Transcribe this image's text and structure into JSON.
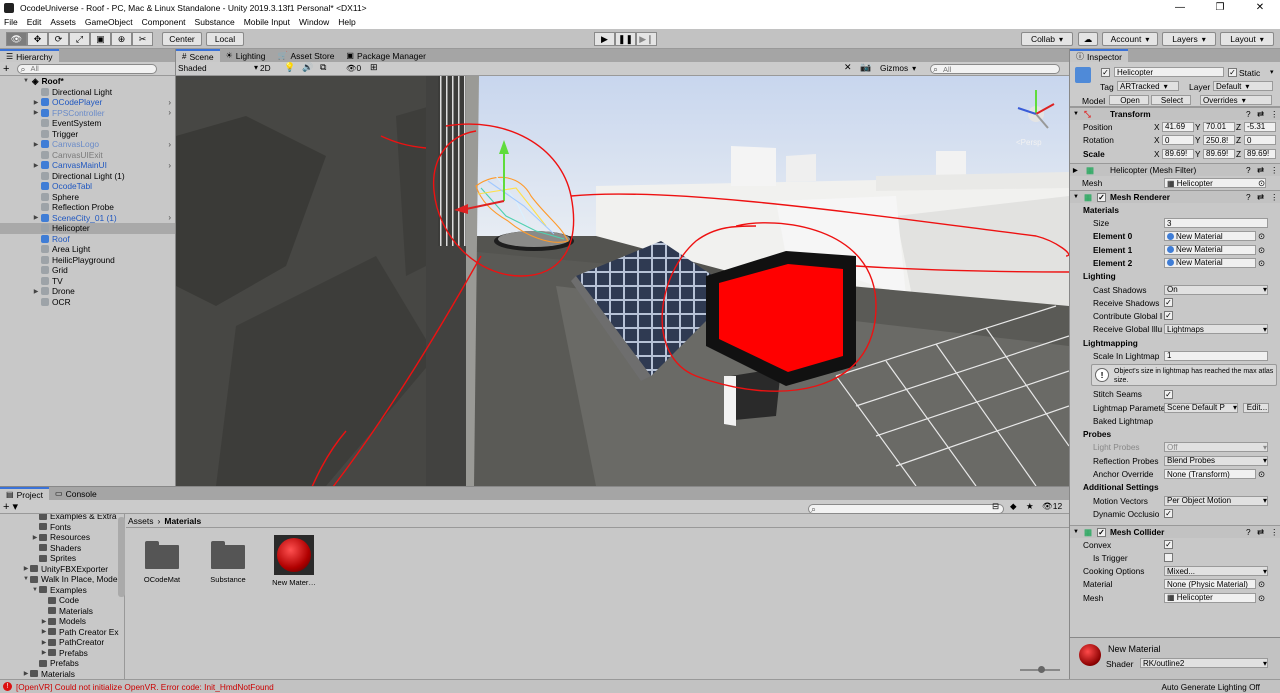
{
  "titlebar": {
    "title": "OcodeUniverse - Roof - PC, Mac & Linux Standalone - Unity 2019.3.13f1 Personal* <DX11>",
    "minimize": "—",
    "maximize": "❐",
    "close": "✕"
  },
  "menu": [
    "File",
    "Edit",
    "Assets",
    "GameObject",
    "Component",
    "Substance",
    "Mobile Input",
    "Window",
    "Help"
  ],
  "toolbar": {
    "center": "Center",
    "local": "Local",
    "collab": "Collab",
    "account": "Account",
    "layers": "Layers",
    "layout": "Layout"
  },
  "hierarchy": {
    "tab": "Hierarchy",
    "add": "+",
    "search_placeholder": "All",
    "root": "Roof*",
    "items": [
      {
        "label": "Directional Light",
        "style": "normal",
        "arrow": ""
      },
      {
        "label": "OCodePlayer",
        "style": "blue",
        "arrow": "▶"
      },
      {
        "label": "FPSController",
        "style": "bluegrey",
        "arrow": "▶"
      },
      {
        "label": "EventSystem",
        "style": "normal",
        "arrow": ""
      },
      {
        "label": "Trigger",
        "style": "normal",
        "arrow": ""
      },
      {
        "label": "CanvasLogo",
        "style": "bluegrey",
        "arrow": "▶"
      },
      {
        "label": "CanvasUIExit",
        "style": "grey",
        "arrow": ""
      },
      {
        "label": "CanvasMainUI",
        "style": "blue",
        "arrow": "▶"
      },
      {
        "label": "Directional Light (1)",
        "style": "normal",
        "arrow": ""
      },
      {
        "label": "OcodeTabl",
        "style": "blue",
        "arrow": ""
      },
      {
        "label": "Sphere",
        "style": "normal",
        "arrow": ""
      },
      {
        "label": "Reflection Probe",
        "style": "normal",
        "arrow": ""
      },
      {
        "label": "SceneCity_01 (1)",
        "style": "blue",
        "arrow": "▶"
      },
      {
        "label": "Helicopter",
        "style": "normal",
        "arrow": "",
        "selected": true
      },
      {
        "label": "Roof",
        "style": "blue",
        "arrow": ""
      },
      {
        "label": "Area Light",
        "style": "normal",
        "arrow": ""
      },
      {
        "label": "HeilicPlayground",
        "style": "normal",
        "arrow": ""
      },
      {
        "label": "Grid",
        "style": "normal",
        "arrow": ""
      },
      {
        "label": "TV",
        "style": "normal",
        "arrow": ""
      },
      {
        "label": "Drone",
        "style": "normal",
        "arrow": "▶"
      },
      {
        "label": "OCR",
        "style": "normal",
        "arrow": ""
      }
    ]
  },
  "scene": {
    "tabs": [
      "Scene",
      "Lighting",
      "Asset Store",
      "Package Manager"
    ],
    "shading": "Shaded",
    "mode2d": "2D",
    "layers_count": "0",
    "gizmos": "Gizmos",
    "search_placeholder": "All",
    "persp": "<Persp"
  },
  "project": {
    "tabs": [
      "Project",
      "Console"
    ],
    "breadcrumb": [
      "Assets",
      "Materials"
    ],
    "count": "12",
    "tree": [
      {
        "label": "Examples & Extra",
        "indent": 1,
        "arrow": ""
      },
      {
        "label": "Fonts",
        "indent": 1,
        "arrow": ""
      },
      {
        "label": "Resources",
        "indent": 1,
        "arrow": "▶"
      },
      {
        "label": "Shaders",
        "indent": 1,
        "arrow": ""
      },
      {
        "label": "Sprites",
        "indent": 1,
        "arrow": ""
      },
      {
        "label": "UnityFBXExporter",
        "indent": 0,
        "arrow": "▶"
      },
      {
        "label": "Walk In Place, Mode",
        "indent": 0,
        "arrow": "▼"
      },
      {
        "label": "Examples",
        "indent": 1,
        "arrow": "▼"
      },
      {
        "label": "Code",
        "indent": 2,
        "arrow": ""
      },
      {
        "label": "Materials",
        "indent": 2,
        "arrow": ""
      },
      {
        "label": "Models",
        "indent": 2,
        "arrow": "▶"
      },
      {
        "label": "Path Creator Ex",
        "indent": 2,
        "arrow": "▶"
      },
      {
        "label": "PathCreator",
        "indent": 2,
        "arrow": "▶"
      },
      {
        "label": "Prefabs",
        "indent": 2,
        "arrow": "▶"
      },
      {
        "label": "Prefabs",
        "indent": 1,
        "arrow": ""
      },
      {
        "label": "Materials",
        "indent": 0,
        "arrow": "▶"
      }
    ],
    "assets": [
      {
        "label": "OCodeMat",
        "kind": "folder"
      },
      {
        "label": "Substance",
        "kind": "folder"
      },
      {
        "label": "New Mater…",
        "kind": "material"
      }
    ]
  },
  "inspector": {
    "tab": "Inspector",
    "name": "Helicopter",
    "static": "Static",
    "tag_label": "Tag",
    "tag": "ARTracked",
    "layer_label": "Layer",
    "layer": "Default",
    "model_label": "Model",
    "open": "Open",
    "select": "Select",
    "overrides": "Overrides",
    "transform": {
      "title": "Transform",
      "position": {
        "label": "Position",
        "x": "41.69",
        "y": "70.01",
        "z": "-5.31"
      },
      "rotation": {
        "label": "Rotation",
        "x": "0",
        "y": "250.8!",
        "z": "0"
      },
      "scale": {
        "label": "Scale",
        "x": "89.69!",
        "y": "89.69!",
        "z": "89.69!"
      }
    },
    "meshfilter": {
      "title": "Helicopter (Mesh Filter)",
      "mesh_label": "Mesh",
      "mesh": "Helicopter"
    },
    "renderer": {
      "title": "Mesh Renderer",
      "materials": "Materials",
      "size_label": "Size",
      "size": "3",
      "elements": [
        {
          "label": "Element 0",
          "value": "New Material"
        },
        {
          "label": "Element 1",
          "value": "New Material"
        },
        {
          "label": "Element 2",
          "value": "New Material"
        }
      ],
      "lighting": "Lighting",
      "cast_label": "Cast Shadows",
      "cast": "On",
      "receive": "Receive Shadows",
      "contribute": "Contribute Global I",
      "receive_gi_label": "Receive Global Illu",
      "receive_gi": "Lightmaps",
      "lightmapping": "Lightmapping",
      "scale_label": "Scale In Lightmap",
      "scale": "1",
      "warning": "Object's size in lightmap has reached the max atlas size.",
      "stitch": "Stitch Seams",
      "params_label": "Lightmap Paramete",
      "params": "Scene Default P",
      "edit": "Edit...",
      "baked": "Baked Lightmap",
      "probes": "Probes",
      "light_probes_label": "Light Probes",
      "light_probes": "Off",
      "refl_label": "Reflection Probes",
      "refl": "Blend Probes",
      "anchor_label": "Anchor Override",
      "anchor": "None (Transform)",
      "additional": "Additional Settings",
      "motion_label": "Motion Vectors",
      "motion": "Per Object Motion",
      "dynamic": "Dynamic Occlusio"
    },
    "collider": {
      "title": "Mesh Collider",
      "convex": "Convex",
      "trigger": "Is Trigger",
      "cooking_label": "Cooking Options",
      "cooking": "Mixed...",
      "material_label": "Material",
      "material": "None (Physic Material)",
      "mesh_label": "Mesh",
      "mesh": "Helicopter"
    },
    "matpreview": {
      "name": "New Material",
      "shader_label": "Shader",
      "shader": "RK/outline2"
    }
  },
  "status": {
    "error": "[OpenVR] Could not initialize OpenVR. Error code: Init_HmdNotFound",
    "right": "Auto Generate Lighting Off"
  }
}
